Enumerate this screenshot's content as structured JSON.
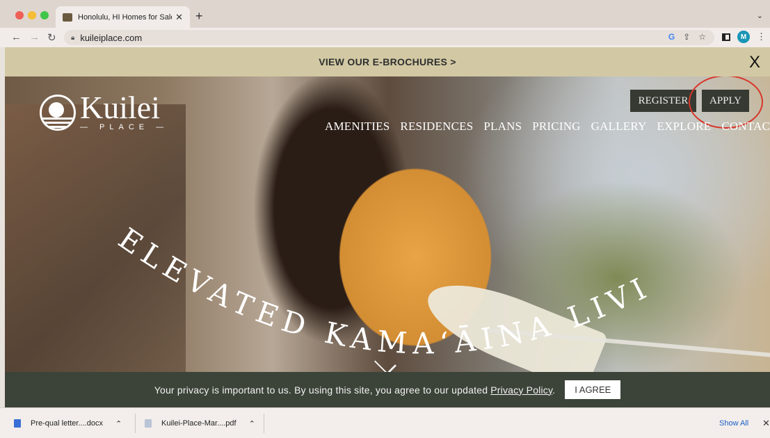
{
  "browser": {
    "tab_title": "Honolulu, HI Homes for Sale | K",
    "url": "kuileiplace.com",
    "profile_initial": "M"
  },
  "banner": {
    "link": "VIEW OUR E-BROCHURES >",
    "close": "X"
  },
  "logo": {
    "name": "Kuilei",
    "sub": "— PLACE —"
  },
  "header": {
    "register": "REGISTER",
    "apply": "APPLY",
    "nav": [
      "AMENITIES",
      "RESIDENCES",
      "PLANS",
      "PRICING",
      "GALLERY",
      "EXPLORE",
      "CONTACT"
    ]
  },
  "hero": {
    "tagline": "ELEVATED KAMAʻĀINA LIVING"
  },
  "privacy": {
    "text": "Your privacy is important to us. By using this site, you agree to our updated ",
    "link": "Privacy Policy",
    "period": ".",
    "agree": "I AGREE"
  },
  "downloads": {
    "items": [
      {
        "name": "Pre-qual letter....docx"
      },
      {
        "name": "Kuilei-Place-Mar....pdf"
      }
    ],
    "show_all": "Show All"
  },
  "colors": {
    "banner": "#d2c9a4",
    "privacy_bar": "#3c4439",
    "header_button": "#363a32",
    "highlight_circle": "#d9362a"
  }
}
